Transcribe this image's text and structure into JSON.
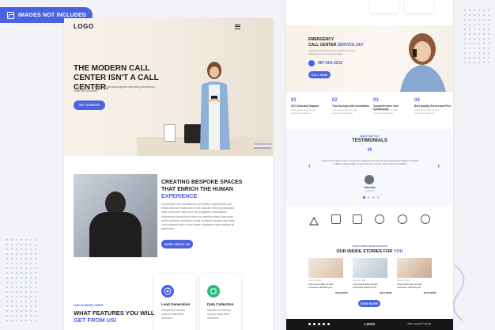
{
  "badge": {
    "label": "IMAGES NOT INCLUDED",
    "icon": "image-icon"
  },
  "left": {
    "logo": "LOGO",
    "hero": {
      "title": "THE MODERN CALL CENTER ISN'T A CALL CENTER.",
      "desc": "It's a network of virtual, on-demand agents delivering unmatched scale and flexibility.",
      "button": "GET STARTED"
    },
    "about": {
      "title_line1": "CREATING BESPOKE SPACES",
      "title_line2": "THAT ENRICH THE HUMAN",
      "title_accent": "EXPERIENCE",
      "para": "Consectetur sem accusamus ut provident culpa tenetur qui officia deserunt mollit anim id est laborum. Sed ut perspiciatis unde omnis iste natus error sit voluptatem accusantium doloremque laudantium totam rem aperiam eaque ipsa quae ab illo inventore veritatis et quasi architecto beatae vitae dicta sunt explicabo nemo enim ipsam voluptatem quia voluptas sit aspernatur.",
      "button": "MORE ABOUT US"
    },
    "features": {
      "kicker": "OUR COURSES OFFER",
      "title_line1": "WHAT FEATURES YOU WILL",
      "title_accent": "GET FROM US!",
      "cards": [
        {
          "title": "Lead Generation",
          "desc": "Sample text dummy copy for lead office document",
          "icon": "target-icon",
          "color": "#4a63e0"
        },
        {
          "title": "Data Collection",
          "desc": "Sample text dummy copy for data office document",
          "icon": "database-icon",
          "color": "#2db87d"
        }
      ]
    }
  },
  "right": {
    "emergency": {
      "line1": "EMERGENCY",
      "line2": "CALL CENTER",
      "accent": "SERVICE 24/7",
      "desc": "Sample text lorem ipsum dolor sit amet consectetur adipiscing elit sed do eiusmod tempor.",
      "phone": "987-654-3210",
      "button": "CALL NOW"
    },
    "features": [
      {
        "num": "01",
        "title": "24/7 Dedicated Support",
        "desc": "Lorem ipsum dolor sit amet consectetur adipiscing"
      },
      {
        "num": "02",
        "title": "Time Savings with Consultants",
        "desc": "Lorem ipsum dolor sit amet consectetur adipiscing"
      },
      {
        "num": "03",
        "title": "Comprehensive Cost Containment",
        "desc": "Lorem ipsum dolor sit amet consectetur adipiscing"
      },
      {
        "num": "04",
        "title": "Best Quality, Service and Price",
        "desc": "Lorem ipsum dolor sit amet consectetur adipiscing"
      }
    ],
    "testimonials": {
      "kicker": "WHAT THEY SAY",
      "title": "TESTIMONIALS",
      "quote": "Lorem ipsum dolor sit amet, consectetur adipiscing elit, sed do eiusmod tempor incididunt ut labore et dolore magna aliqua. Ut enim ad minim veniam, quis nostrud exercitation.",
      "name": "John Doe",
      "role": "Customer",
      "prev": "‹",
      "next": "›"
    },
    "stories": {
      "kicker": "LATEST NEWS FROM OUR BLOG",
      "title": "OUR INSIDE STORIES FOR",
      "accent": "YOU",
      "items": [
        {
          "date": "June 12, 2021",
          "text": "Lorem ipsum dolor sit amet, consectetur adipiscing elit.",
          "more": "READ MORE"
        },
        {
          "date": "June 12, 2021",
          "text": "Lorem ipsum dolor sit amet, consectetur adipiscing elit.",
          "more": "READ MORE"
        },
        {
          "date": "June 12, 2021",
          "text": "Lorem ipsum dolor sit amet, consectetur adipiscing elit.",
          "more": "READ MORE"
        }
      ],
      "button": "VIEW MORE"
    },
    "footer": {
      "logo": "LOGO",
      "copyright": "2021 Copyright © Freepik"
    }
  },
  "colors": {
    "accent": "#4a63e0",
    "green": "#2db87d",
    "dark": "#161616"
  }
}
